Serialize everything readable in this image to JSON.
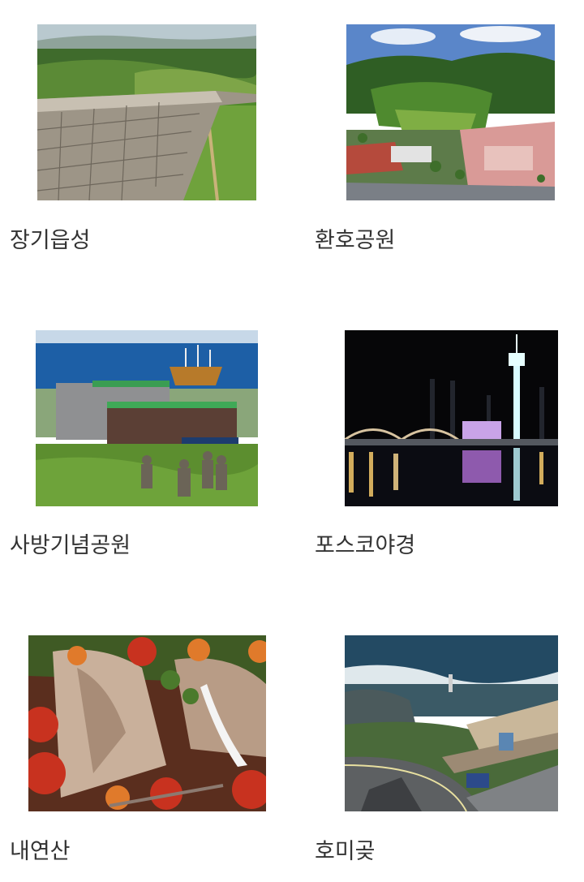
{
  "attractions": [
    {
      "name": "장기읍성",
      "image": "fortress-wall-photo"
    },
    {
      "name": "환호공원",
      "image": "park-aerial-photo"
    },
    {
      "name": "사방기념공원",
      "image": "memorial-park-sea-photo"
    },
    {
      "name": "포스코야경",
      "image": "posco-night-view-photo"
    },
    {
      "name": "내연산",
      "image": "waterfall-autumn-photo"
    },
    {
      "name": "호미곶",
      "image": "coastal-cape-photo"
    }
  ]
}
